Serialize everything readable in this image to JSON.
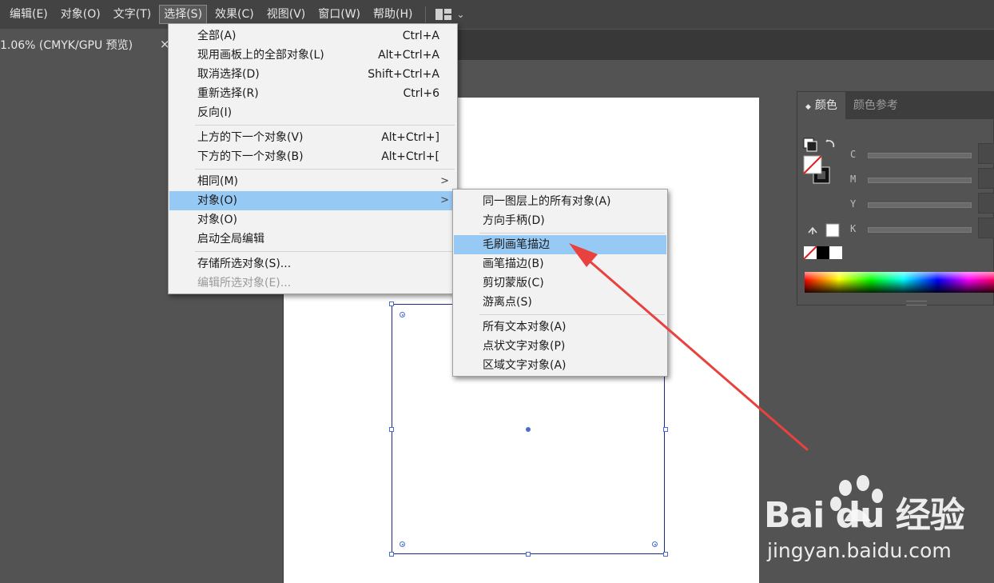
{
  "menubar": {
    "items": [
      "编辑(E)",
      "对象(O)",
      "文字(T)",
      "选择(S)",
      "效果(C)",
      "视图(V)",
      "窗口(W)",
      "帮助(H)"
    ],
    "active_index": 3
  },
  "document_tab": {
    "title": "1.06% (CMYK/GPU 预览)",
    "close": "×"
  },
  "select_menu": {
    "items": [
      {
        "label": "全部(A)",
        "shortcut": "Ctrl+A"
      },
      {
        "label": "现用画板上的全部对象(L)",
        "shortcut": "Alt+Ctrl+A"
      },
      {
        "label": "取消选择(D)",
        "shortcut": "Shift+Ctrl+A"
      },
      {
        "label": "重新选择(R)",
        "shortcut": "Ctrl+6"
      },
      {
        "label": "反向(I)",
        "shortcut": ""
      },
      {
        "label": "上方的下一个对象(V)",
        "shortcut": "Alt+Ctrl+]"
      },
      {
        "label": "下方的下一个对象(B)",
        "shortcut": "Alt+Ctrl+["
      },
      {
        "label": "相同(M)",
        "shortcut": "",
        "submenu": true
      },
      {
        "label": "对象(O)",
        "shortcut": "",
        "submenu": true,
        "highlighted": true
      },
      {
        "label": "对象(O)",
        "shortcut": ""
      },
      {
        "label": "启动全局编辑",
        "shortcut": ""
      },
      {
        "label": "存储所选对象(S)...",
        "shortcut": ""
      },
      {
        "label": "编辑所选对象(E)...",
        "shortcut": "",
        "disabled": true
      }
    ]
  },
  "object_submenu": {
    "items": [
      {
        "label": "同一图层上的所有对象(A)"
      },
      {
        "label": "方向手柄(D)"
      },
      {
        "label": "毛刷画笔描边",
        "highlighted": true
      },
      {
        "label": "画笔描边(B)"
      },
      {
        "label": "剪切蒙版(C)"
      },
      {
        "label": "游离点(S)"
      },
      {
        "label": "所有文本对象(A)"
      },
      {
        "label": "点状文字对象(P)"
      },
      {
        "label": "区域文字对象(A)"
      }
    ]
  },
  "color_panel": {
    "tabs": [
      "颜色",
      "颜色参考"
    ],
    "active_tab": 0,
    "channels": [
      "C",
      "M",
      "Y",
      "K"
    ]
  },
  "annotation": {
    "color": "#e8423f"
  },
  "watermark": {
    "logo": "Bai du 经验",
    "url": "jingyan.baidu.com"
  },
  "colors": {
    "highlight": "#97c9f5",
    "menubar": "#434343",
    "canvas": "#535353",
    "selection": "#1e2a8a"
  }
}
